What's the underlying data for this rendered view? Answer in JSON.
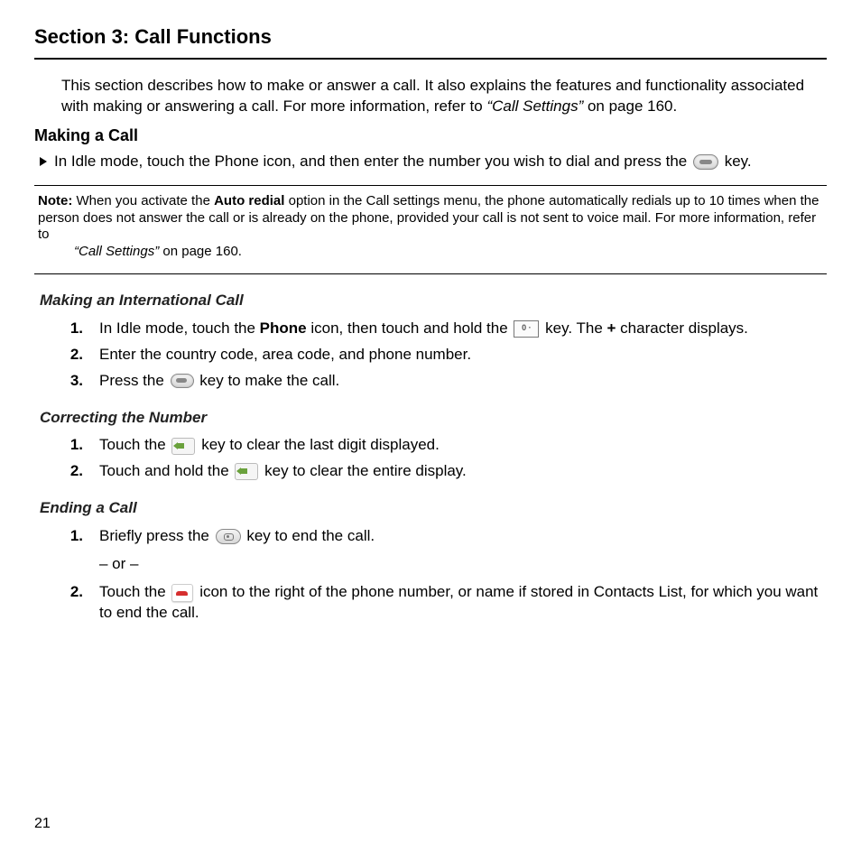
{
  "section_title": "Section 3: Call Functions",
  "intro": {
    "p1a": "This section describes how to make or answer a call. It also explains the features and functionality associated with making or answering a call. For more information, refer to ",
    "ref": "“Call Settings”",
    "p1b": "  on page 160."
  },
  "making_a_call": {
    "heading": "Making a Call",
    "line_a": "In Idle mode, touch the Phone icon, and then enter the number you wish to dial and press the ",
    "line_b": " key."
  },
  "note": {
    "label": "Note:",
    "a": " When you activate the ",
    "bold": "Auto redial",
    "b": " option in the Call settings menu, the phone automatically redials up to 10 times when the person does not answer the call or is already on the phone, provided your call is not sent to voice mail. For more information, refer to ",
    "ref": "“Call Settings”",
    "c": "  on page 160."
  },
  "intl": {
    "heading": "Making an International Call",
    "s1a": "In Idle mode, touch the ",
    "s1bold": "Phone",
    "s1b": " icon, then touch and hold the ",
    "key0": "0 ·",
    "s1c": " key. The ",
    "plus": "+",
    "s1d": " character displays.",
    "s2": "Enter the country code, area code, and phone number.",
    "s3a": "Press the ",
    "s3b": " key to make the call."
  },
  "correct": {
    "heading": "Correcting the Number",
    "s1a": "Touch the ",
    "s1b": " key to clear the last digit displayed.",
    "s2a": "Touch and hold the ",
    "s2b": " key to clear the entire display."
  },
  "ending": {
    "heading": "Ending a Call",
    "s1a": "Briefly press the ",
    "s1b": " key to end the call.",
    "or": "– or –",
    "s2a": "Touch the ",
    "s2b": " icon to the right of the phone number, or name if stored in Contacts List, for which you want to end the call."
  },
  "page_number": "21"
}
